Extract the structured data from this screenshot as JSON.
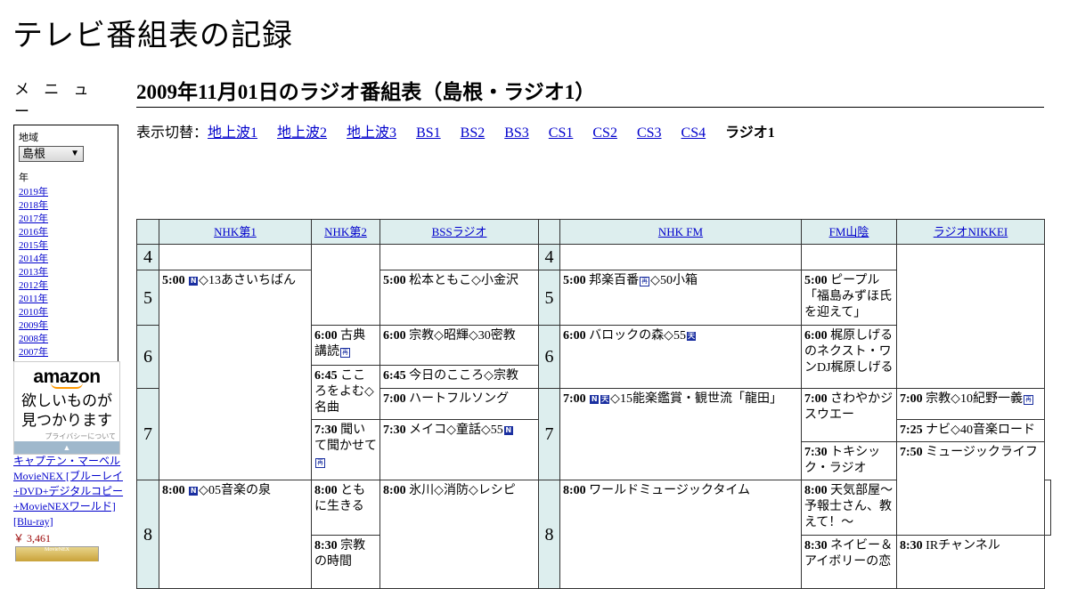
{
  "site": {
    "title": "テレビ番組表の記録"
  },
  "sidebar": {
    "menu_title": "メ ニ ュ ー",
    "region_label": "地域",
    "region_value": "島根",
    "year_label": "年",
    "years": [
      "2019年",
      "2018年",
      "2017年",
      "2016年",
      "2015年",
      "2014年",
      "2013年",
      "2012年",
      "2011年",
      "2010年",
      "2009年",
      "2008年",
      "2007年"
    ]
  },
  "ad": {
    "logo": "amazon",
    "catch1": "欲しいものが",
    "catch2": "見つかります",
    "privacy": "プライバシーについて",
    "product_title": "キャプテン・マーベル MovieNEX [ブルーレイ+DVD+デジタルコピー+MovieNEXワールド] [Blu-ray]",
    "product_price": "￥ 3,461",
    "thumb_text": "MovieNEX"
  },
  "page": {
    "heading": "2009年11月01日のラジオ番組表（島根・ラジオ1）"
  },
  "switcher": {
    "label": "表示切替：",
    "links": [
      "地上波1",
      "地上波2",
      "地上波3",
      "BS1",
      "BS2",
      "BS3",
      "CS1",
      "CS2",
      "CS3",
      "CS4"
    ],
    "current": "ラジオ1"
  },
  "schedule": {
    "channels": [
      "NHK第1",
      "NHK第2",
      "BSSラジオ",
      "NHK FM",
      "FM山陰",
      "ラジオNIKKEI"
    ],
    "hours": [
      "4",
      "5",
      "6",
      "7",
      "8"
    ],
    "programs": {
      "nhk1_500": {
        "time": "5:00",
        "title": "◇13あさいちばん"
      },
      "nhk1_800": {
        "time": "8:00",
        "title": "◇05音楽の泉"
      },
      "nhk2_600": {
        "time": "6:00",
        "title": "古典講読"
      },
      "nhk2_645": {
        "time": "6:45",
        "title": "こころをよむ◇名曲"
      },
      "nhk2_730": {
        "time": "7:30",
        "title": "聞いて聞かせて"
      },
      "nhk2_800": {
        "time": "8:00",
        "title": "ともに生きる"
      },
      "nhk2_830": {
        "time": "8:30",
        "title": "宗教の時間"
      },
      "bss_500": {
        "time": "5:00",
        "title": "松本ともこ◇小金沢"
      },
      "bss_600": {
        "time": "6:00",
        "title": "宗教◇昭輝◇30密教"
      },
      "bss_645": {
        "time": "6:45",
        "title": "今日のこころ◇宗教"
      },
      "bss_700": {
        "time": "7:00",
        "title": "ハートフルソング"
      },
      "bss_730": {
        "time": "7:30",
        "title": "メイコ◇童話◇55"
      },
      "bss_800": {
        "time": "8:00",
        "title": "氷川◇消防◇レシピ"
      },
      "fm_500": {
        "time": "5:00",
        "title": "邦楽百番",
        "title2": "◇50小箱"
      },
      "fm_600": {
        "time": "6:00",
        "title": "バロックの森◇55"
      },
      "fm_700": {
        "time": "7:00",
        "title": "◇15能楽鑑賞・観世流「龍田」"
      },
      "fm_800": {
        "time": "8:00",
        "title": "ワールドミュージックタイム"
      },
      "san_500": {
        "time": "5:00",
        "title": "ピープル「福島みずほ氏を迎えて」"
      },
      "san_600": {
        "time": "6:00",
        "title": "梶原しげるのネクスト・ワンDJ梶原しげる"
      },
      "san_700": {
        "time": "7:00",
        "title": "さわやかジスウエー"
      },
      "san_730": {
        "time": "7:30",
        "title": "トキシック・ラジオ"
      },
      "san_800": {
        "time": "8:00",
        "title": "天気部屋～予報士さん、教えて！～"
      },
      "san_830": {
        "time": "8:30",
        "title": "ネイビー＆アイボリーの恋"
      },
      "nik_700": {
        "time": "7:00",
        "title": "宗教◇10紀野一義"
      },
      "nik_725": {
        "time": "7:25",
        "title": "ナビ◇40音楽ロード"
      },
      "nik_750": {
        "time": "7:50",
        "title": "ミュージックライフ"
      },
      "nik_830": {
        "time": "8:30",
        "title": "IRチャンネル"
      }
    },
    "icons": {
      "news": "N",
      "rebroadcast": "再",
      "weather": "天"
    }
  },
  "colors": {
    "header_bg": "#ddeeee",
    "link": "#0000cc",
    "icon_blue": "#1a2fa0"
  }
}
